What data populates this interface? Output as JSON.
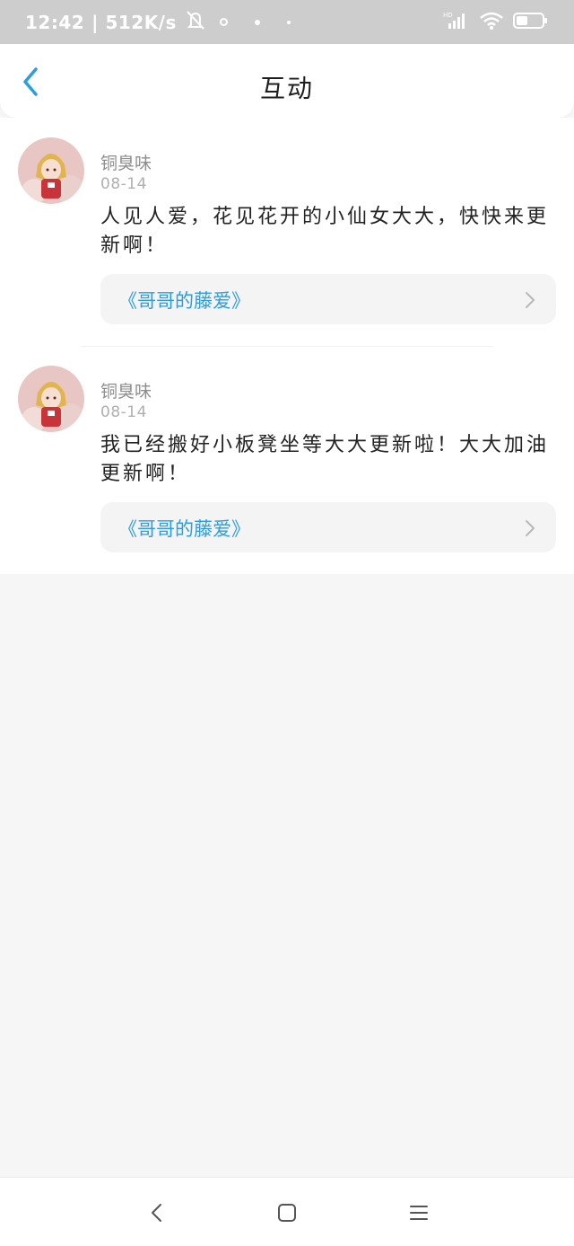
{
  "status_bar": {
    "time": "12:42",
    "speed": "| 512K/s",
    "network_label": "HD"
  },
  "header": {
    "title": "互动"
  },
  "interactions": [
    {
      "username": "铜臭味",
      "date": "08-14",
      "comment": "人见人爱，花见花开的小仙女大大，快快来更新啊！",
      "book_title": "《哥哥的藤爱》"
    },
    {
      "username": "铜臭味",
      "date": "08-14",
      "comment": "我已经搬好小板凳坐等大大更新啦！大大加油更新啊！",
      "book_title": "《哥哥的藤爱》"
    }
  ],
  "colors": {
    "accent": "#2b9de0",
    "status_bar": "#cdcdcd",
    "page_background": "#f7f6f7"
  },
  "icons": {
    "back": "chevron-left-icon",
    "link_arrow": "chevron-right-icon",
    "nav_back": "nav-back-icon",
    "nav_home": "nav-home-icon",
    "nav_menu": "nav-menu-icon"
  }
}
